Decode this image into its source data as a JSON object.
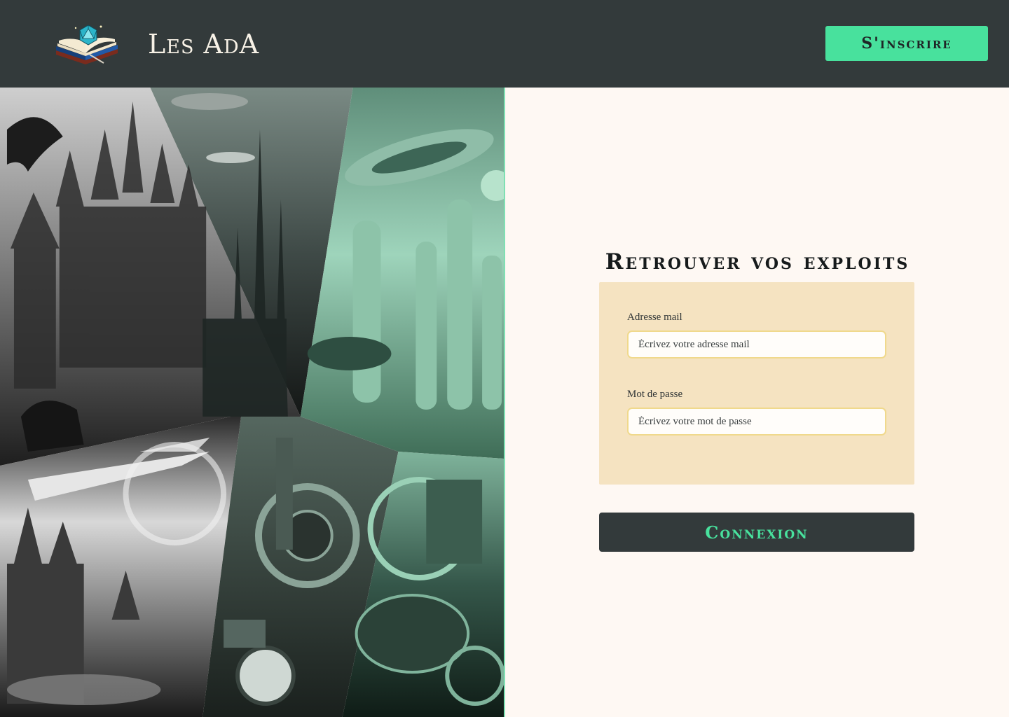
{
  "header": {
    "brand": "Les AdA",
    "logo_icon": "open-book-d20-icon",
    "signup_label": "S'inscrire"
  },
  "illustration": {
    "icon": "fantasy-scifi-collage-image"
  },
  "login": {
    "title": "Retrouver vos exploits",
    "email_label": "Adresse mail",
    "email_placeholder": "Écrivez votre adresse mail",
    "password_label": "Mot de passe",
    "password_placeholder": "Écrivez votre mot de passe",
    "submit_label": "Connexion"
  },
  "colors": {
    "header_bg": "#333a3b",
    "accent": "#48e19d",
    "page_bg": "#fef8f3",
    "card_bg": "#f5e3c1",
    "input_border": "#f0d98c"
  }
}
